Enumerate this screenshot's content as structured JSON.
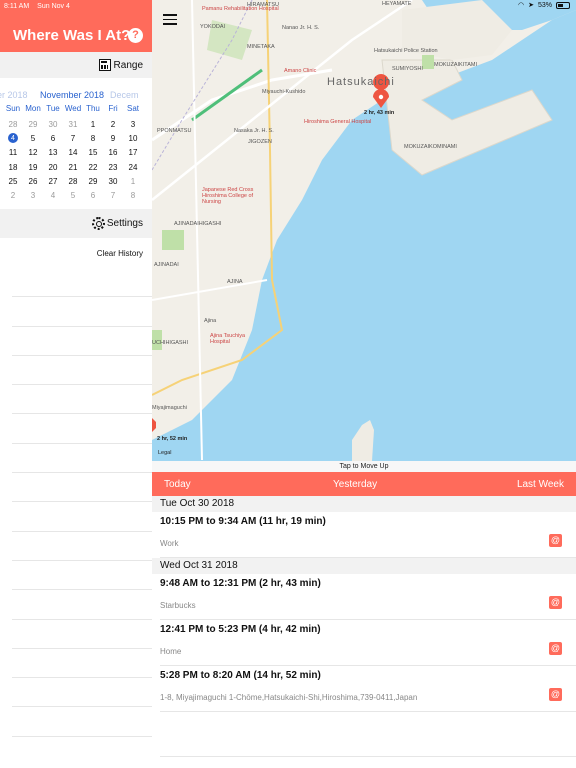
{
  "status": {
    "time": "8:11 AM",
    "date": "Sun Nov 4",
    "battery": "53%"
  },
  "sidebar": {
    "title": "Where Was I At?",
    "help_icon": "?",
    "range_label": "Range",
    "calendar": {
      "prev_month": "er 2018",
      "month": "November 2018",
      "next_month": "Decem",
      "days_of_week": [
        "Sun",
        "Mon",
        "Tue",
        "Wed",
        "Thu",
        "Fri",
        "Sat"
      ],
      "weeks": [
        [
          "28",
          "29",
          "30",
          "31",
          "1",
          "2",
          "3"
        ],
        [
          "4",
          "5",
          "6",
          "7",
          "8",
          "9",
          "10"
        ],
        [
          "11",
          "12",
          "13",
          "14",
          "15",
          "16",
          "17"
        ],
        [
          "18",
          "19",
          "20",
          "21",
          "22",
          "23",
          "24"
        ],
        [
          "25",
          "26",
          "27",
          "28",
          "29",
          "30",
          "1"
        ],
        [
          "2",
          "3",
          "4",
          "5",
          "6",
          "7",
          "8"
        ]
      ],
      "selected_day": "4"
    },
    "settings_label": "Settings",
    "clear_history": "Clear History"
  },
  "map": {
    "labels": {
      "city": "Hatsukaichi",
      "pin_duration": "2 hr, 43 min",
      "edge_duration": "2 hr, 52 min",
      "legal": "Legal",
      "hiramatsu": "HIRAMATSU",
      "heyamate": "HEYAMATE",
      "yokodai": "YOKODAI",
      "hayashi": "Pamanu Rehabilitation Hospital",
      "minetaka": "MINETAKA",
      "police": "Hatsukaichi Police Station",
      "amano": "Amano Clinic",
      "sumiyoshi": "SUMIYOSHI",
      "mokuzai": "MOKUZAIKITAMI",
      "miyauchi": "Miyauchi-Kushido",
      "pponmatsu": "PPONMATSU",
      "nasaka": "Nasaka Jr. H. S.",
      "hiroshima_hosp": "Hiroshima General Hospital",
      "jigozen": "JIGOZEN",
      "mokuzai_minami": "MOKUZAIKOMINAMI",
      "redcross": "Japanese Red Cross Hiroshima College of Nursing",
      "ajina_high": "AJINADAIHIGASHI",
      "ajinadai": "AJINADAI",
      "ajina": "AJINA",
      "ajina_st": "Ajina",
      "tsuchiya": "Ajina Tsuchiya Hospital",
      "uchihigashi": "UCHIHIGASHI",
      "miyajimaguchi": "Miyajimaguchi",
      "sanyo": "San-yo Line",
      "nanao": "Nanao Jr. H. S."
    }
  },
  "tap_move_up": "Tap to Move Up",
  "tabs": {
    "today": "Today",
    "yesterday": "Yesterday",
    "last_week": "Last Week"
  },
  "history": {
    "sections": [
      {
        "date": "Tue Oct 30 2018",
        "entries": [
          {
            "time": "10:15 PM to 9:34 AM (11 hr, 19 min)",
            "place": "Work"
          }
        ]
      },
      {
        "date": "Wed Oct 31 2018",
        "entries": [
          {
            "time": "9:48 AM to 12:31 PM (2 hr, 43 min)",
            "place": "Starbucks"
          },
          {
            "time": "12:41 PM to 5:23 PM (4 hr, 42 min)",
            "place": "Home"
          },
          {
            "time": "5:28 PM to 8:20 AM (14 hr, 52 min)",
            "place": "1-8, Miyajimaguchi 1-Chōme,Hatsukaichi-Shi,Hiroshima,739-0411,Japan"
          }
        ]
      }
    ],
    "email_icon": "@"
  },
  "colors": {
    "accent": "#ff6b5b",
    "calendar_blue": "#2962cf",
    "water": "#9fd6f2"
  }
}
